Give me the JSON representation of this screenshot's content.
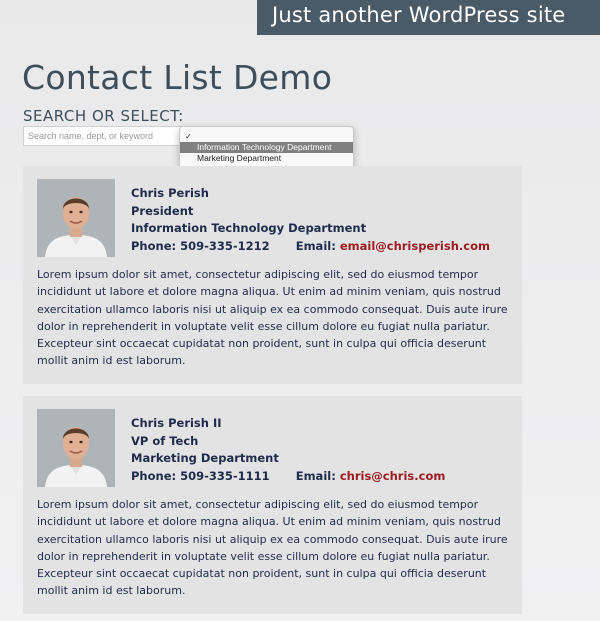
{
  "site": {
    "banner": "Just another WordPress site"
  },
  "page": {
    "title": "Contact List Demo"
  },
  "search": {
    "label": "SEARCH OR SELECT:",
    "placeholder": "Search name, dept, or keyword",
    "dropdown": {
      "check_mark": "✓",
      "options": [
        "",
        "Information Technology Department",
        "Marketing Department"
      ],
      "highlighted": "Information Technology Department"
    }
  },
  "contacts": [
    {
      "name": "Chris Perish",
      "title": "President",
      "department": "Information Technology Department",
      "phone_label": "Phone:",
      "phone": "509-335-1212",
      "email_label": "Email:",
      "email": "email@chrisperish.com",
      "bio": "Lorem ipsum dolor sit amet, consectetur adipiscing elit, sed do eiusmod tempor incididunt ut labore et dolore magna aliqua. Ut enim ad minim veniam, quis nostrud exercitation ullamco laboris nisi ut aliquip ex ea commodo consequat. Duis aute irure dolor in reprehenderit in voluptate velit esse cillum dolore eu fugiat nulla pariatur. Excepteur sint occaecat cupidatat non proident, sunt in culpa qui officia deserunt mollit anim id est laborum."
    },
    {
      "name": "Chris Perish II",
      "title": "VP of Tech",
      "department": "Marketing Department",
      "phone_label": "Phone:",
      "phone": "509-335-1111",
      "email_label": "Email:",
      "email": "chris@chris.com",
      "bio": "Lorem ipsum dolor sit amet, consectetur adipiscing elit, sed do eiusmod tempor incididunt ut labore et dolore magna aliqua. Ut enim ad minim veniam, quis nostrud exercitation ullamco laboris nisi ut aliquip ex ea commodo consequat. Duis aute irure dolor in reprehenderit in voluptate velit esse cillum dolore eu fugiat nulla pariatur. Excepteur sint occaecat cupidatat non proident, sunt in culpa qui officia deserunt mollit anim id est laborum."
    }
  ],
  "colors": {
    "banner_bg": "#4a5a67",
    "text_navy": "#1f2a4d",
    "email_red": "#9b1b20",
    "card_bg": "#e3e3e3"
  }
}
